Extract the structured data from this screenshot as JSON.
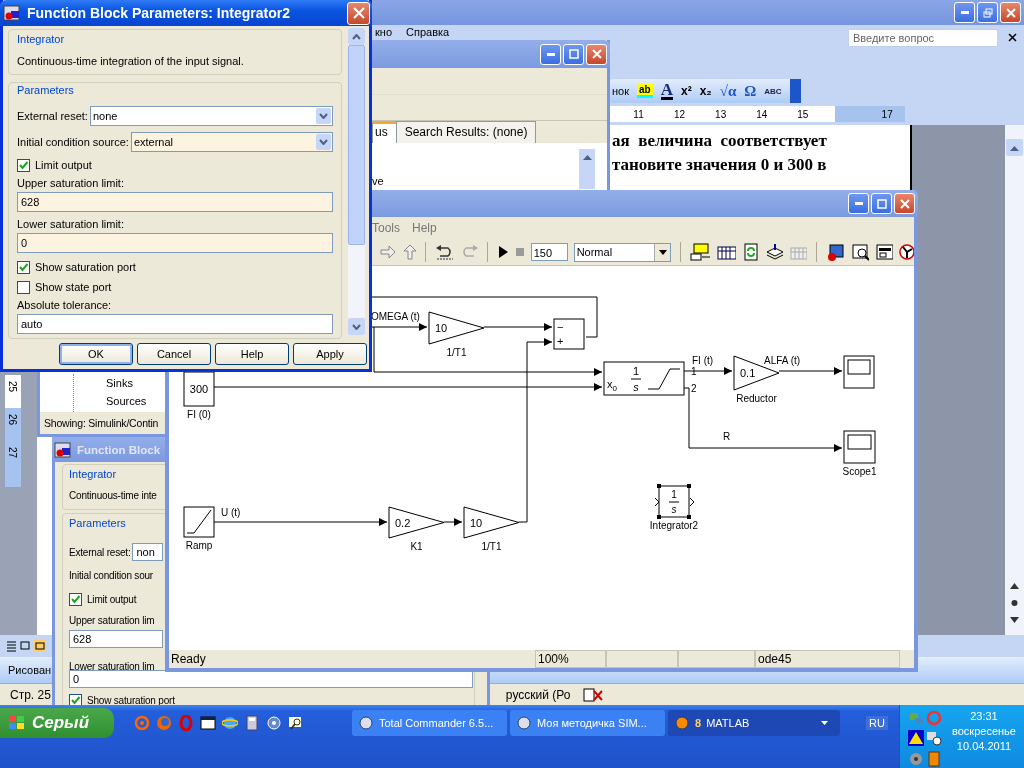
{
  "word": {
    "menu": [
      "кно",
      "Справка"
    ],
    "question": {
      "placeholder": "Введите вопрос"
    },
    "toolbar_label": "нок",
    "format_buttons": [
      "ab",
      "A",
      "x²",
      "x₂",
      "√α",
      "Ω",
      "ABC"
    ],
    "ruler": [
      "11",
      "12",
      "13",
      "14",
      "15",
      "17"
    ],
    "vertical_ruler": [
      "25",
      "26",
      "27"
    ],
    "document_lines": [
      "ая  величина  соответствует",
      "тановите значения 0 и 300 в"
    ],
    "drawing_toolbar": "Рисован",
    "status": {
      "page": "Стр. 25",
      "language": "русский (Ро"
    }
  },
  "library_browser": {
    "tabs": [
      {
        "label": "us",
        "selected": true
      },
      {
        "label": "Search Results: (none)",
        "selected": false
      }
    ],
    "tree_fragment": "ve",
    "tree_items": [
      "Sinks",
      "Sources"
    ],
    "status": "Showing: Simulink/Contin"
  },
  "block_dialog_behind": {
    "title": "Function Block",
    "group": "Integrator",
    "description": "Continuous-time inte",
    "parameters_label": "Parameters",
    "rows": [
      {
        "kind": "inline",
        "label": "External reset:",
        "value": "non"
      },
      {
        "kind": "label",
        "label": "Initial condition sour"
      },
      {
        "kind": "checkbox",
        "label": "Limit output",
        "checked": true
      },
      {
        "kind": "text",
        "label": "Upper saturation lim",
        "value": "628"
      },
      {
        "kind": "text",
        "label": "Lower saturation lim",
        "value": "0"
      },
      {
        "kind": "checkbox",
        "label": "Show saturation port",
        "checked": true
      }
    ]
  },
  "model_window": {
    "menu": [
      "Tools",
      "Help"
    ],
    "stop_time": "150",
    "mode": "Normal",
    "blocks": [
      {
        "kind": "gain",
        "value": "10",
        "label": "1/T1"
      },
      {
        "kind": "sum",
        "signs": [
          "−",
          "+"
        ]
      },
      {
        "kind": "limited_integrator",
        "port_label": "x",
        "port_subscript": "0",
        "numerator": "1",
        "denominator": "s",
        "outputs": [
          "1",
          "2"
        ]
      },
      {
        "kind": "constant",
        "value": "300",
        "label": "FI (0)"
      },
      {
        "kind": "gain",
        "value": "0.1",
        "label": "Reductor"
      },
      {
        "kind": "scope"
      },
      {
        "kind": "scope",
        "label": "Scope1"
      },
      {
        "kind": "ramp",
        "label": "Ramp"
      },
      {
        "kind": "gain",
        "value": "0.2",
        "label": "K1"
      },
      {
        "kind": "gain",
        "value": "10",
        "label": "1/T1"
      },
      {
        "kind": "integrator",
        "numerator": "1",
        "denominator": "s",
        "label": "Integrator2",
        "selected": true
      }
    ],
    "signals": [
      "OMEGA (t)",
      "FI (t)",
      "ALFA (t)",
      "R",
      "U (t)"
    ],
    "status": [
      "Ready",
      "100%",
      "ode45"
    ]
  },
  "block_dialog": {
    "title": "Function Block Parameters: Integrator2",
    "group": "Integrator",
    "description": "Continuous-time integration of the input signal.",
    "parameters_label": "Parameters",
    "rows": [
      {
        "kind": "select",
        "label": "External reset:",
        "value": "none",
        "modified": false
      },
      {
        "kind": "select",
        "label": "Initial condition source:",
        "value": "external",
        "modified": true
      },
      {
        "kind": "checkbox",
        "label": "Limit output",
        "checked": true
      },
      {
        "kind": "text",
        "label": "Upper saturation limit:",
        "value": "628",
        "modified": true
      },
      {
        "kind": "text",
        "label": "Lower saturation limit:",
        "value": "0",
        "modified": true
      },
      {
        "kind": "checkbox",
        "label": "Show saturation port",
        "checked": true
      },
      {
        "kind": "checkbox",
        "label": "Show state port",
        "checked": false
      },
      {
        "kind": "text",
        "label": "Absolute tolerance:",
        "value": "auto",
        "modified": false
      }
    ],
    "buttons": [
      {
        "label": "OK",
        "default": true
      },
      {
        "label": "Cancel",
        "default": false
      },
      {
        "label": "Help",
        "default": false
      },
      {
        "label": "Apply",
        "default": false
      }
    ]
  },
  "taskbar": {
    "start": "Серый",
    "tasks": [
      {
        "label": "Total Commander 6.5...",
        "selected": false
      },
      {
        "label": "Моя методичка SIM...",
        "selected": false
      },
      {
        "count": "8",
        "label": "MATLAB",
        "selected": true
      }
    ],
    "language": "RU",
    "time": "23:31",
    "day": "воскресенье",
    "date": "10.04.2011"
  }
}
